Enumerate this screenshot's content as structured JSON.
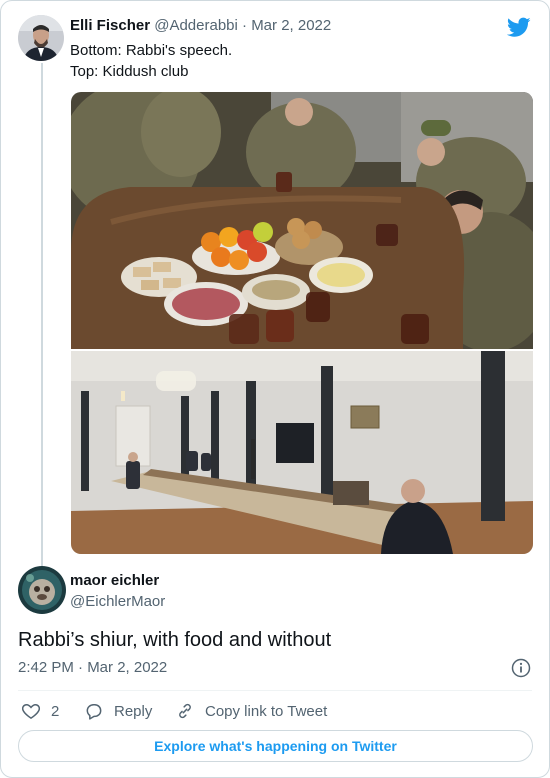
{
  "quoted_tweet": {
    "author_name": "Elli Fischer",
    "author_handle": "@Adderabbi",
    "separator": "·",
    "date": "Mar 2, 2022",
    "text_line1": "Bottom: Rabbi's speech.",
    "text_line2": "Top: Kiddush club"
  },
  "tweet": {
    "author_name": "maor eichler",
    "author_handle": "@EichlerMaor",
    "text": "Rabbi’s shiur, with food and without",
    "timestamp": "2:42 PM · Mar 2, 2022"
  },
  "actions": {
    "like_count": "2",
    "reply_label": "Reply",
    "copy_label": "Copy link to Tweet"
  },
  "explore_label": "Explore what's happening on Twitter",
  "icons": [
    "twitter-bird-icon",
    "info-icon",
    "heart-icon",
    "reply-icon",
    "link-icon"
  ],
  "colors": {
    "accent": "#1d9bf0",
    "muted": "#536471",
    "border": "#cfd9de"
  }
}
